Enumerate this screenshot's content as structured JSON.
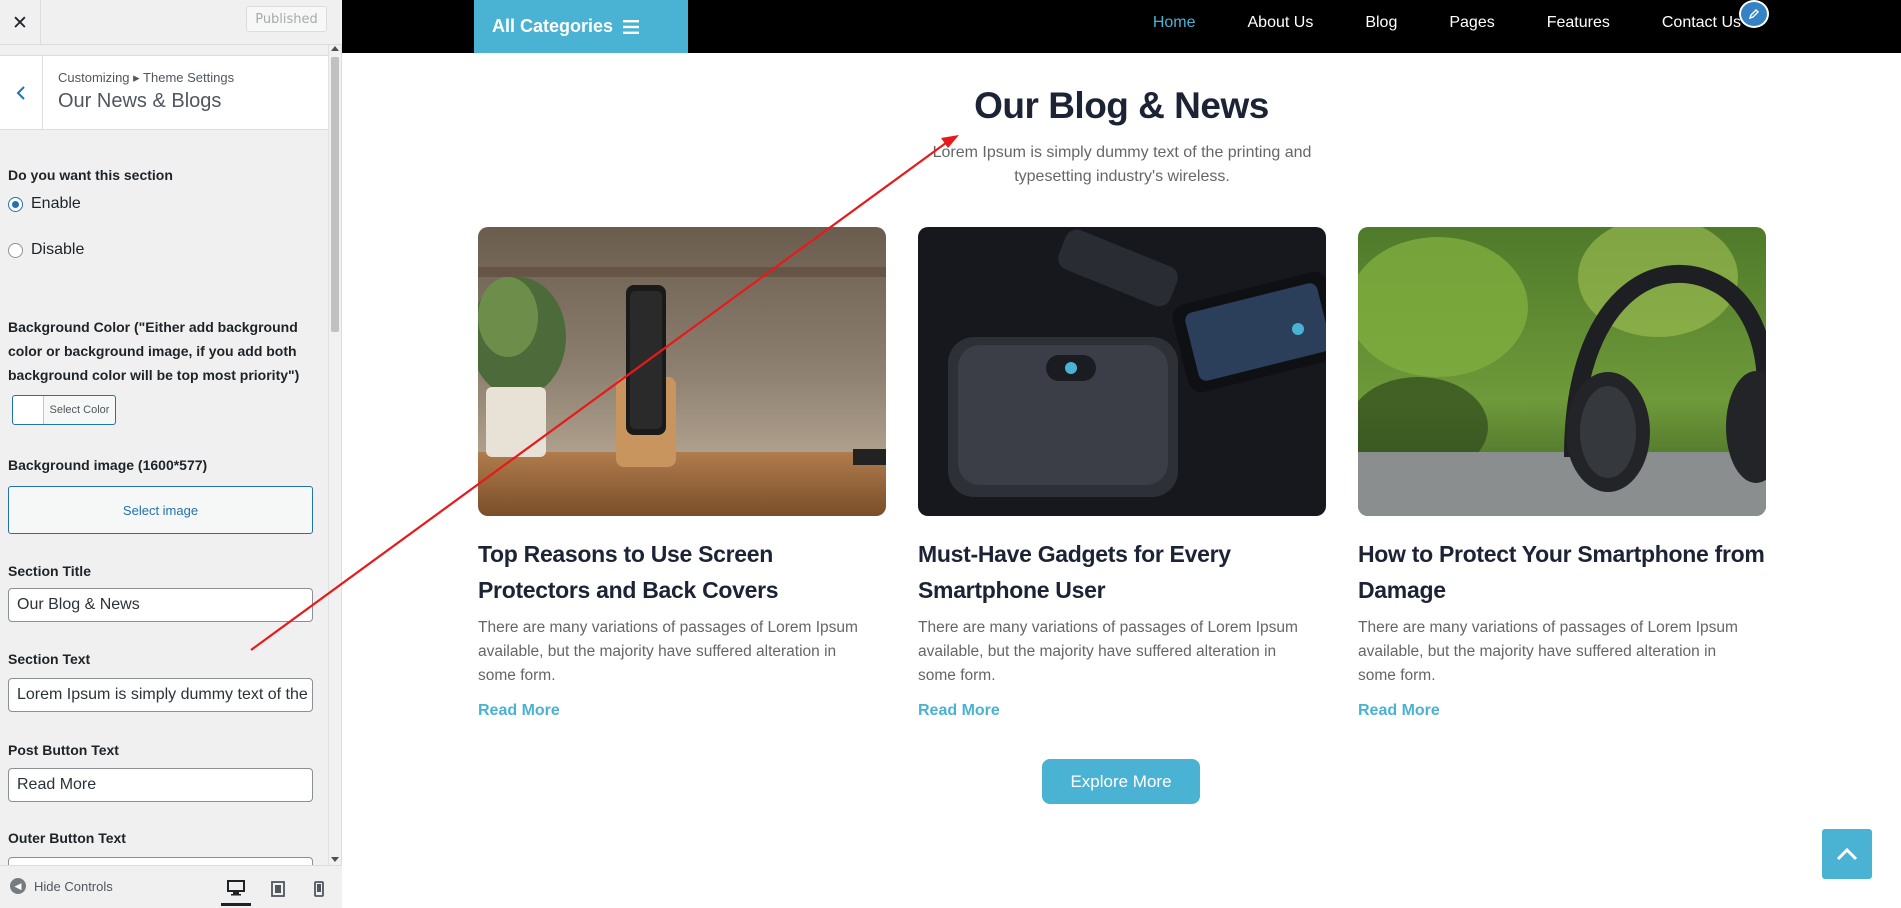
{
  "customizer": {
    "close_label": "✕",
    "publish_label": "Published",
    "breadcrumb": "Customizing ▸ Theme Settings",
    "section_title": "Our News & Blogs",
    "enable_question": "Do you want this section",
    "radio_enable": "Enable",
    "radio_disable": "Disable",
    "radio_selected": "Enable",
    "bg_color_label": "Background Color (\"Either add background color or background image, if you add both background color will be top most priority\")",
    "select_color_label": "Select Color",
    "bg_image_label": "Background image (1600*577)",
    "select_image_label": "Select image",
    "section_title_label": "Section Title",
    "section_title_value": "Our Blog  &  News",
    "section_text_label": "Section Text",
    "section_text_value": "Lorem Ipsum is simply dummy text of the printing and typesetting industry's wireless.",
    "post_button_label": "Post Button Text",
    "post_button_value": "Read More",
    "outer_button_label": "Outer Button Text",
    "hide_controls_label": "Hide Controls",
    "devices": [
      "desktop-icon",
      "tablet-icon",
      "mobile-icon"
    ],
    "active_device": "desktop"
  },
  "preview": {
    "all_categories_label": "All Categories",
    "nav": [
      {
        "label": "Home",
        "active": true
      },
      {
        "label": "About Us",
        "active": false
      },
      {
        "label": "Blog",
        "active": false
      },
      {
        "label": "Pages",
        "active": false
      },
      {
        "label": "Features",
        "active": false
      },
      {
        "label": "Contact Us",
        "active": false
      }
    ],
    "section_title": "Our Blog & News",
    "section_text": "Lorem Ipsum is simply dummy text of the printing and typesetting industry's wireless.",
    "posts": [
      {
        "image": "phone-on-wooden-stand",
        "title": "Top Reasons to Use Screen Protectors and Back Covers",
        "excerpt": "There are many variations of passages of Lorem Ipsum available, but the majority have suffered alteration in some form.",
        "read_more": "Read More"
      },
      {
        "image": "portable-speaker-and-phone",
        "title": "Must-Have Gadgets for Every Smartphone User",
        "excerpt": "There are many variations of passages of Lorem Ipsum available, but the majority have suffered alteration in some form.",
        "read_more": "Read More"
      },
      {
        "image": "headphones-on-table",
        "title": "How to Protect Your Smartphone from Damage",
        "excerpt": "There are many variations of passages of Lorem Ipsum available, but the majority have suffered alteration in some form.",
        "read_more": "Read More"
      }
    ],
    "explore_label": "Explore More",
    "accent_color": "#4ab3d4",
    "nav_bg": "#000000"
  },
  "annotation": {
    "type": "arrow",
    "color": "#e8191b"
  }
}
